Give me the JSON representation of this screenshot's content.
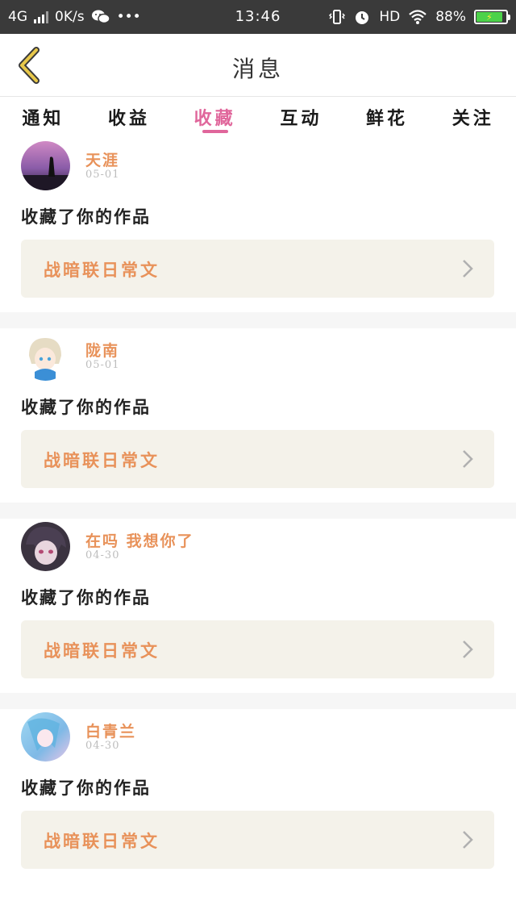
{
  "status_bar": {
    "network": "4G",
    "speed": "0K/s",
    "more": "•••",
    "time": "13:46",
    "hd": "HD",
    "battery": "88%",
    "battery_level": 0.88
  },
  "header": {
    "title": "消息"
  },
  "tabs": [
    {
      "label": "通知",
      "active": false
    },
    {
      "label": "收益",
      "active": false
    },
    {
      "label": "收藏",
      "active": true
    },
    {
      "label": "互动",
      "active": false
    },
    {
      "label": "鲜花",
      "active": false
    },
    {
      "label": "关注",
      "active": false
    }
  ],
  "items": [
    {
      "name": "天涯",
      "date": "05-01",
      "action": "收藏了你的作品",
      "work": "战暗联日常文"
    },
    {
      "name": "陇南",
      "date": "05-01",
      "action": "收藏了你的作品",
      "work": "战暗联日常文"
    },
    {
      "name": "在吗 我想你了",
      "date": "04-30",
      "action": "收藏了你的作品",
      "work": "战暗联日常文"
    },
    {
      "name": "白青兰",
      "date": "04-30",
      "action": "收藏了你的作品",
      "work": "战暗联日常文"
    }
  ],
  "colors": {
    "accent_pink": "#e0669b",
    "name_orange": "#e8925a",
    "card_bg": "#f4f2ea",
    "back_arrow": "#e8c84a"
  }
}
